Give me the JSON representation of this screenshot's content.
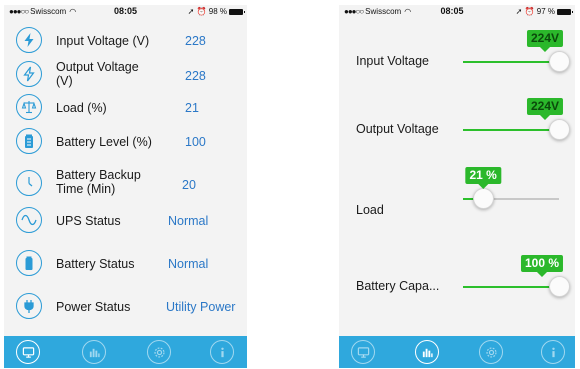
{
  "status_left": {
    "carrier": "Swisscom",
    "time": "08:05",
    "battery": "98 %"
  },
  "status_right": {
    "carrier": "Swisscom",
    "time": "08:05",
    "battery": "97 %"
  },
  "status_list": [
    {
      "label": "Input Voltage (V)",
      "value": "228",
      "icon": "lightning-bolt-icon"
    },
    {
      "label": "Output Voltage (V)",
      "value": "228",
      "icon": "lightning-bolt-outline-icon"
    },
    {
      "label": "Load (%)",
      "value": "21",
      "icon": "balance-scale-icon"
    },
    {
      "label": "Battery Level (%)",
      "value": "100",
      "icon": "battery-level-icon"
    },
    {
      "label": "Battery Backup Time (Min)",
      "value": "20",
      "icon": "clock-icon"
    },
    {
      "label": "UPS Status",
      "value": "Normal",
      "icon": "sine-wave-icon"
    },
    {
      "label": "Battery Status",
      "value": "Normal",
      "icon": "battery-icon"
    },
    {
      "label": "Power Status",
      "value": "Utility Power",
      "icon": "power-plug-icon"
    }
  ],
  "sliders": [
    {
      "label": "Input Voltage",
      "badge": "224V",
      "level_fraction": 1.0
    },
    {
      "label": "Output Voltage",
      "badge": "224V",
      "level_fraction": 1.0
    },
    {
      "label": "Load",
      "badge": "21 %",
      "level_fraction": 0.21
    },
    {
      "label": "Battery Capa...",
      "badge": "100 %",
      "level_fraction": 1.0
    }
  ],
  "tabs": [
    {
      "icon": "monitor-icon"
    },
    {
      "icon": "bar-chart-icon"
    },
    {
      "icon": "settings-gear-icon"
    },
    {
      "icon": "info-icon"
    }
  ],
  "colors": {
    "accent_blue": "#2fa8dd",
    "value_blue": "#2b78c7",
    "badge_green": "#2bb82b",
    "background": "#f3f3f3"
  }
}
